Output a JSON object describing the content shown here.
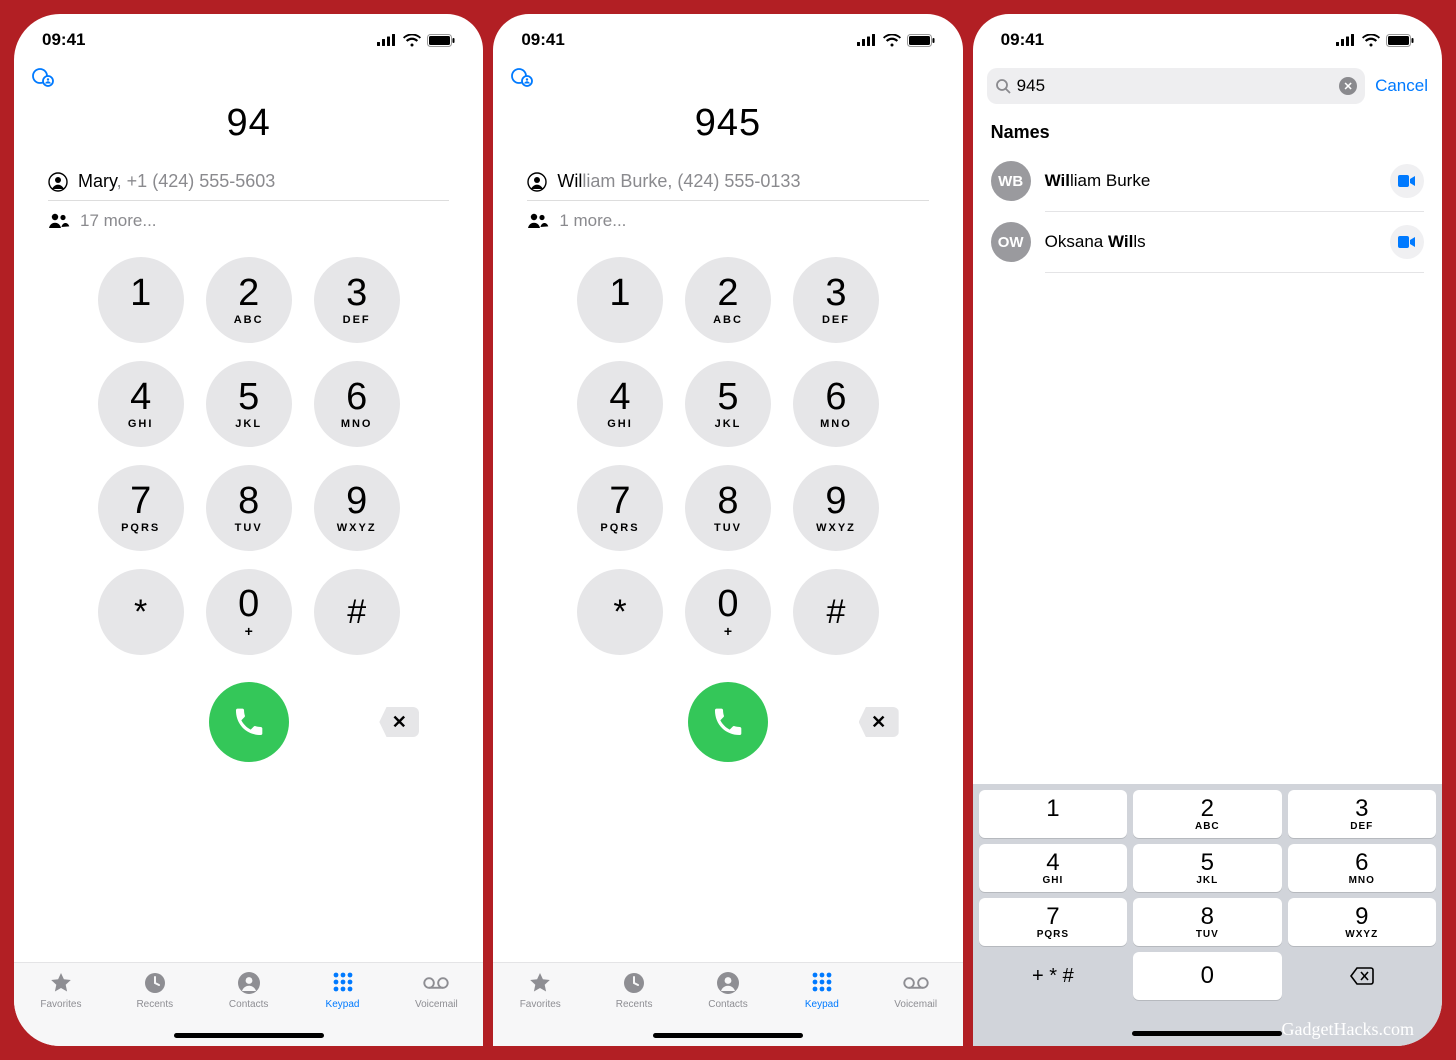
{
  "credit": "GadgetHacks.com",
  "status_time": "09:41",
  "screens": [
    {
      "entered": "94",
      "suggest_name": "Mary",
      "suggest_detail": ", +1 (424) 555-5603",
      "more": "17 more..."
    },
    {
      "entered": "945",
      "highlight_prefix": "Wil",
      "suggest_name_rest": "liam Burke",
      "suggest_detail": ", (424) 555-0133",
      "more": "1 more..."
    }
  ],
  "search": {
    "query": "945",
    "cancel": "Cancel",
    "section": "Names",
    "results": [
      {
        "initials": "WB",
        "bold": "Wil",
        "rest": "liam Burke"
      },
      {
        "initials": "OW",
        "pre": "Oksana ",
        "bold": "Wil",
        "rest": "ls"
      }
    ]
  },
  "keypad": [
    {
      "d": "1",
      "l": ""
    },
    {
      "d": "2",
      "l": "ABC"
    },
    {
      "d": "3",
      "l": "DEF"
    },
    {
      "d": "4",
      "l": "GHI"
    },
    {
      "d": "5",
      "l": "JKL"
    },
    {
      "d": "6",
      "l": "MNO"
    },
    {
      "d": "7",
      "l": "PQRS"
    },
    {
      "d": "8",
      "l": "TUV"
    },
    {
      "d": "9",
      "l": "WXYZ"
    },
    {
      "d": "*",
      "l": ""
    },
    {
      "d": "0",
      "l": "+"
    },
    {
      "d": "#",
      "l": ""
    }
  ],
  "tabs": [
    {
      "label": "Favorites"
    },
    {
      "label": "Recents"
    },
    {
      "label": "Contacts"
    },
    {
      "label": "Keypad"
    },
    {
      "label": "Voicemail"
    }
  ],
  "numkb": [
    [
      {
        "d": "1",
        "l": ""
      },
      {
        "d": "2",
        "l": "ABC"
      },
      {
        "d": "3",
        "l": "DEF"
      }
    ],
    [
      {
        "d": "4",
        "l": "GHI"
      },
      {
        "d": "5",
        "l": "JKL"
      },
      {
        "d": "6",
        "l": "MNO"
      }
    ],
    [
      {
        "d": "7",
        "l": "PQRS"
      },
      {
        "d": "8",
        "l": "TUV"
      },
      {
        "d": "9",
        "l": "WXYZ"
      }
    ]
  ],
  "numkb_bottom": {
    "sym": "+ * #",
    "zero": "0"
  }
}
